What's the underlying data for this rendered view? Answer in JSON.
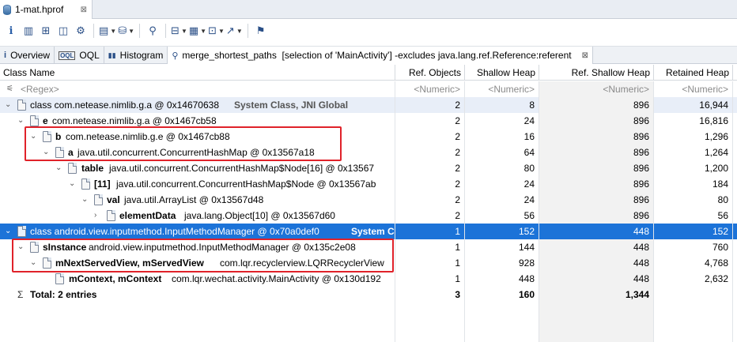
{
  "editor_tab": {
    "title": "1-mat.hprof",
    "close": "⊠"
  },
  "view_tabs": [
    {
      "icon": "i",
      "label": "Overview"
    },
    {
      "icon": "OQL",
      "label": "OQL"
    },
    {
      "icon": "▮▮",
      "label": "Histogram"
    },
    {
      "icon": "⚲",
      "label": "merge_shortest_paths  [selection of 'MainActivity'] -excludes java.lang.ref.Reference:referent",
      "close": "⊠"
    }
  ],
  "columns": {
    "name": "Class Name",
    "ref_objects": "Ref. Objects",
    "shallow_heap": "Shallow Heap",
    "ref_shallow_heap": "Ref. Shallow Heap",
    "retained_heap": "Retained Heap"
  },
  "filter_row": {
    "name": "<Regex>",
    "ref_objects": "<Numeric>",
    "shallow_heap": "<Numeric>",
    "ref_shallow_heap": "<Numeric>",
    "retained_heap": "<Numeric>"
  },
  "rows": [
    {
      "bold": "",
      "text": "class com.netease.nimlib.g.a @ 0x14670638",
      "gc": "System Class, JNI Global",
      "ref": "2",
      "shallow": "8",
      "refshallow": "896",
      "retained": "16,944"
    },
    {
      "bold": "e",
      "text": "com.netease.nimlib.g.a @ 0x1467cb58",
      "gc": "",
      "ref": "2",
      "shallow": "24",
      "refshallow": "896",
      "retained": "16,816"
    },
    {
      "bold": "b",
      "text": "com.netease.nimlib.g.e @ 0x1467cb88",
      "gc": "",
      "ref": "2",
      "shallow": "16",
      "refshallow": "896",
      "retained": "1,296"
    },
    {
      "bold": "a",
      "text": "java.util.concurrent.ConcurrentHashMap @ 0x13567a18",
      "gc": "",
      "ref": "2",
      "shallow": "64",
      "refshallow": "896",
      "retained": "1,264"
    },
    {
      "bold": "table",
      "text": "java.util.concurrent.ConcurrentHashMap$Node[16] @ 0x13567",
      "gc": "",
      "ref": "2",
      "shallow": "80",
      "refshallow": "896",
      "retained": "1,200"
    },
    {
      "bold": "[11]",
      "text": "java.util.concurrent.ConcurrentHashMap$Node @ 0x13567ab",
      "gc": "",
      "ref": "2",
      "shallow": "24",
      "refshallow": "896",
      "retained": "184"
    },
    {
      "bold": "val",
      "text": "java.util.ArrayList @ 0x13567d48",
      "gc": "",
      "ref": "2",
      "shallow": "24",
      "refshallow": "896",
      "retained": "80"
    },
    {
      "bold": "elementData",
      "text": "java.lang.Object[10] @ 0x13567d60",
      "gc": "",
      "ref": "2",
      "shallow": "56",
      "refshallow": "896",
      "retained": "56"
    },
    {
      "bold": "",
      "text": "class android.view.inputmethod.InputMethodManager @ 0x70a0def0",
      "gc": "System C",
      "ref": "1",
      "shallow": "152",
      "refshallow": "448",
      "retained": "152"
    },
    {
      "bold": "sInstance",
      "text": "android.view.inputmethod.InputMethodManager @ 0x135c2e08",
      "gc": "",
      "ref": "1",
      "shallow": "144",
      "refshallow": "448",
      "retained": "760"
    },
    {
      "bold": "mNextServedView, mServedView",
      "text": "com.lqr.recyclerview.LQRRecyclerView",
      "gc": "",
      "ref": "1",
      "shallow": "928",
      "refshallow": "448",
      "retained": "4,768"
    },
    {
      "bold": "mContext, mContext",
      "text": "com.lqr.wechat.activity.MainActivity @ 0x130d192",
      "gc": "",
      "ref": "1",
      "shallow": "448",
      "refshallow": "448",
      "retained": "2,632"
    }
  ],
  "total": {
    "label": "Total: 2 entries",
    "ref": "3",
    "shallow": "160",
    "refshallow": "1,344"
  }
}
